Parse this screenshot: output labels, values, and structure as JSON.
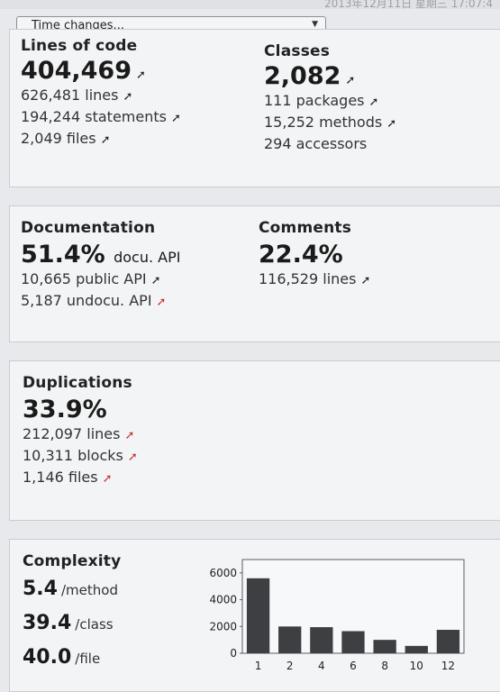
{
  "header": {
    "timestamp_fragment": "2013年12月11日 星期三 17:07:4"
  },
  "time_select": {
    "label": "Time changes..."
  },
  "size": {
    "loc": {
      "heading": "Lines of code",
      "value": "404,469",
      "lines": [
        "626,481 lines",
        "194,244 statements",
        "2,049 files"
      ]
    },
    "classes": {
      "heading": "Classes",
      "value": "2,082",
      "lines": [
        "111 packages",
        "15,252 methods",
        "294 accessors"
      ]
    }
  },
  "docs": {
    "documentation": {
      "heading": "Documentation",
      "value": "51.4%",
      "unit": "docu. API",
      "lines": [
        "10,665 public API",
        "5,187 undocu. API"
      ]
    },
    "comments": {
      "heading": "Comments",
      "value": "22.4%",
      "lines": [
        "116,529 lines"
      ]
    }
  },
  "duplications": {
    "heading": "Duplications",
    "value": "33.9%",
    "lines": [
      "212,097 lines",
      "10,311 blocks",
      "1,146 files"
    ]
  },
  "complexity": {
    "heading": "Complexity",
    "rows": [
      {
        "value": "5.4",
        "unit": "/method"
      },
      {
        "value": "39.4",
        "unit": "/class"
      },
      {
        "value": "40.0",
        "unit": "/file"
      }
    ]
  },
  "colors": {
    "bar": "#3d3f42",
    "arrow_red": "#c43333",
    "arrow_dark": "#222222"
  },
  "icons": {
    "trend": "trend-arrow-icon"
  },
  "chart_data": {
    "type": "bar",
    "categories": [
      "1",
      "2",
      "4",
      "6",
      "8",
      "10",
      "12"
    ],
    "values": [
      5600,
      2000,
      1950,
      1650,
      1000,
      550,
      1750
    ],
    "yticks": [
      "0",
      "2000",
      "4000",
      "6000"
    ],
    "ylim": [
      0,
      7000
    ],
    "grid": false
  }
}
